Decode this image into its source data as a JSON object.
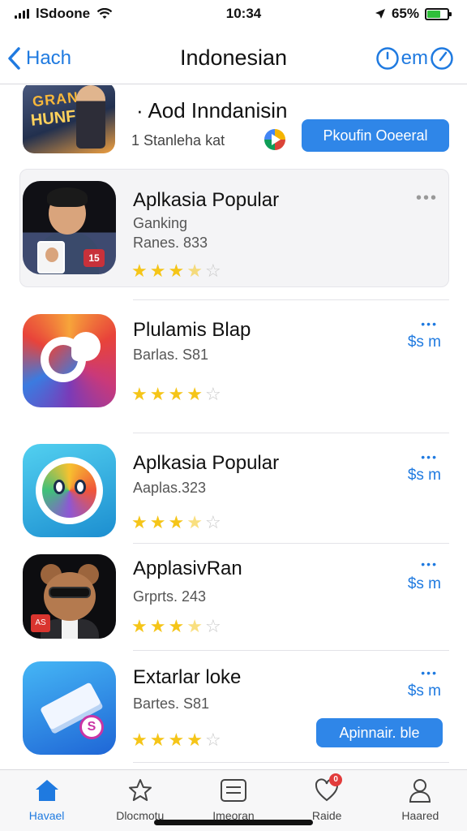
{
  "status_bar": {
    "carrier": "lSdoone",
    "time": "10:34",
    "battery": "65%",
    "battery_level": 0.65
  },
  "nav": {
    "back_label": "Hach",
    "title": "Indonesian",
    "right_label": "em"
  },
  "top_card": {
    "thumb_text_1": "GRANKS",
    "thumb_text_2": "HUNF",
    "title": "· Aod Inndanisin",
    "subtitle": "1 Stanleha kat",
    "button_label": "Pkoufin Ooeeral"
  },
  "apps": [
    {
      "name": "Aplkasia Popular",
      "meta1": "Ganking",
      "meta2": "Ranes. 833",
      "rating": 3.5,
      "action": "•••",
      "badge": "15"
    },
    {
      "name": "Plulamis Blap",
      "meta1": "Barlas. S81",
      "rating": 4,
      "action": "•••",
      "price": "$s m"
    },
    {
      "name": "Aplkasia Popular",
      "meta1": "Aaplas.323",
      "rating": 3.5,
      "action": "•••",
      "price": "$s m"
    },
    {
      "name": "ApplasivRan",
      "meta1": "Grprts. 243",
      "rating": 3.5,
      "action": "•••",
      "price": "$s m",
      "badge": "AS"
    },
    {
      "name": "Extarlar loke",
      "meta1": "Bartes. S81",
      "rating": 4,
      "action": "•••",
      "price": "$s m",
      "button_label": "Apinnair. ble",
      "badge": "S"
    }
  ],
  "tabs": [
    {
      "label": "Havael",
      "icon": "home-icon"
    },
    {
      "label": "Dlocmotu",
      "icon": "star-icon"
    },
    {
      "label": "Imeoran",
      "icon": "list-icon"
    },
    {
      "label": "Raide",
      "icon": "heart-chat-icon",
      "badge": "0"
    },
    {
      "label": "Haared",
      "icon": "person-icon"
    }
  ],
  "colors": {
    "accent": "#1f7ae0",
    "star": "#f5c518",
    "button": "#2f86e8"
  }
}
